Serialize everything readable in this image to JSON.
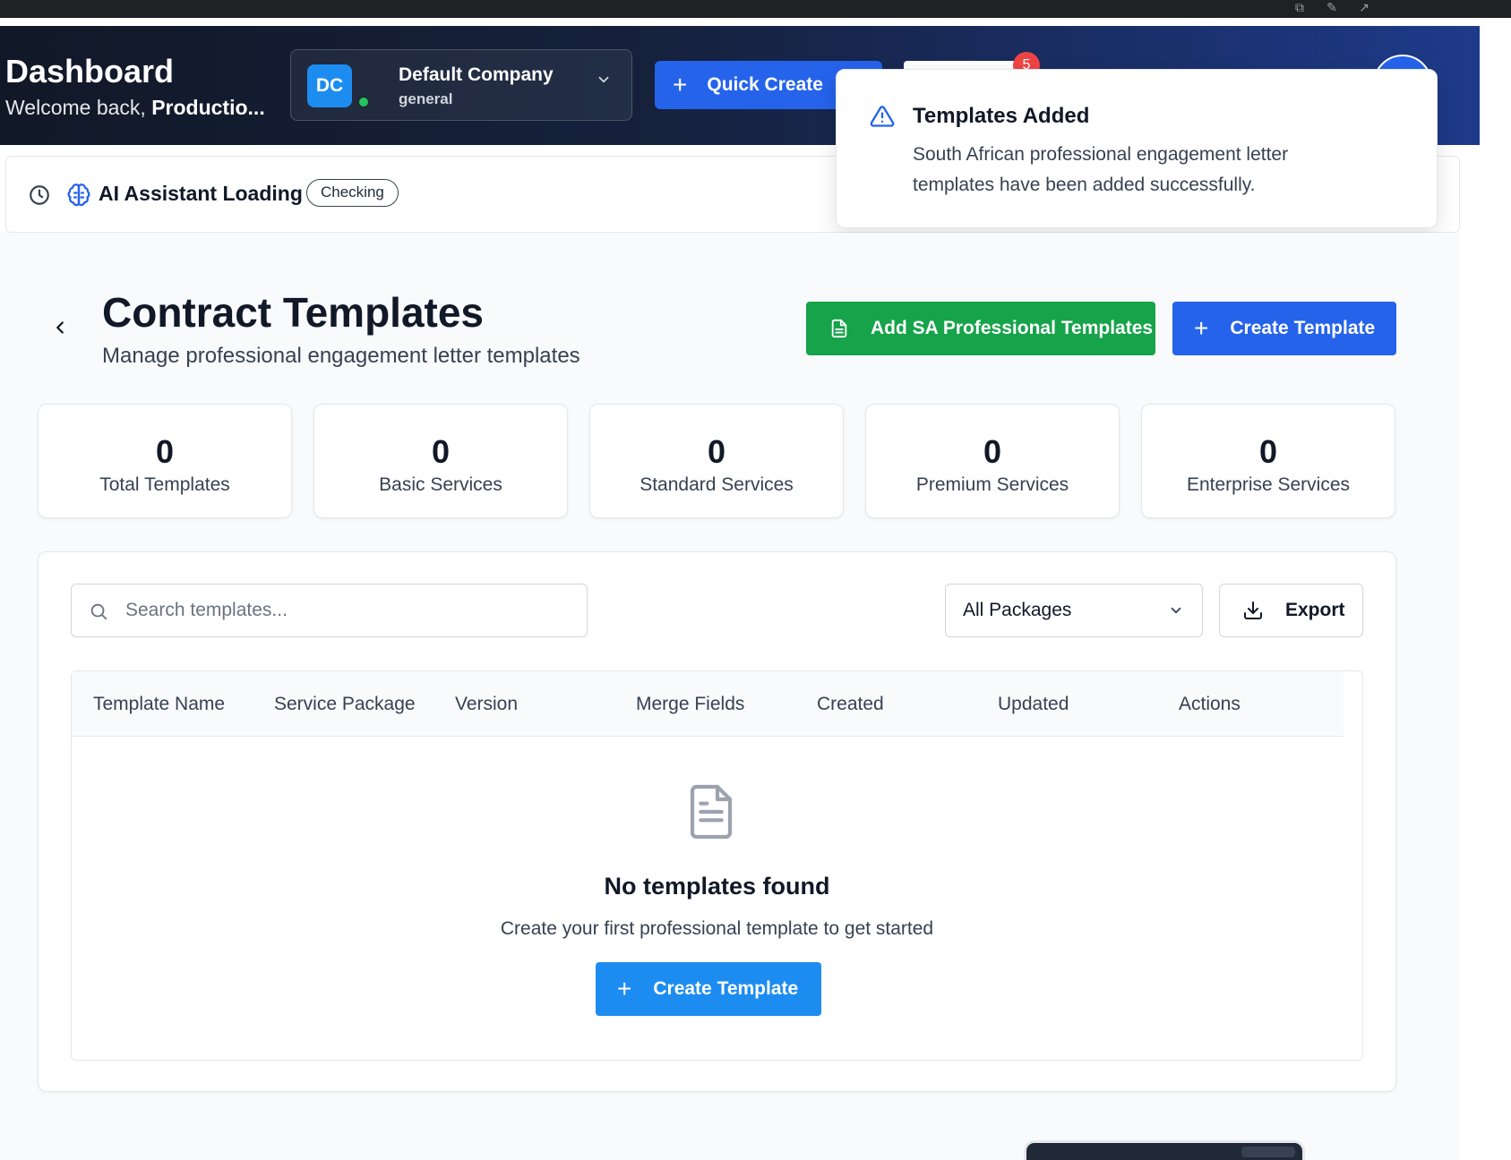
{
  "header": {
    "title": "Dashboard",
    "welcome_prefix": "Welcome back,",
    "user_name": "Productio...",
    "notification_count": "5"
  },
  "company": {
    "initials": "DC",
    "name": "Default Company",
    "plan": "general"
  },
  "quick_create": {
    "label": "Quick Create"
  },
  "toast": {
    "title": "Templates Added",
    "message": "South African professional engagement letter templates have been added successfully."
  },
  "ai_status": {
    "label": "AI Assistant Loading",
    "status": "Checking"
  },
  "page": {
    "title": "Contract Templates",
    "subtitle": "Manage professional engagement letter templates",
    "add_sa_label": "Add SA Professional Templates",
    "create_label": "Create Template"
  },
  "stats": [
    {
      "value": "0",
      "label": "Total Templates"
    },
    {
      "value": "0",
      "label": "Basic Services"
    },
    {
      "value": "0",
      "label": "Standard Services"
    },
    {
      "value": "0",
      "label": "Premium Services"
    },
    {
      "value": "0",
      "label": "Enterprise Services"
    }
  ],
  "filters": {
    "search_placeholder": "Search templates...",
    "package_selected": "All Packages",
    "export_label": "Export"
  },
  "table": {
    "columns": [
      "Template Name",
      "Service Package",
      "Version",
      "Merge Fields",
      "Created",
      "Updated",
      "Actions"
    ]
  },
  "empty_state": {
    "title": "No templates found",
    "subtitle": "Create your first professional template to get started",
    "button_label": "Create Template"
  },
  "colors": {
    "primary": "#2563eb",
    "success": "#16a34a",
    "cta": "#1d8cf0",
    "badge": "#ef4444"
  }
}
